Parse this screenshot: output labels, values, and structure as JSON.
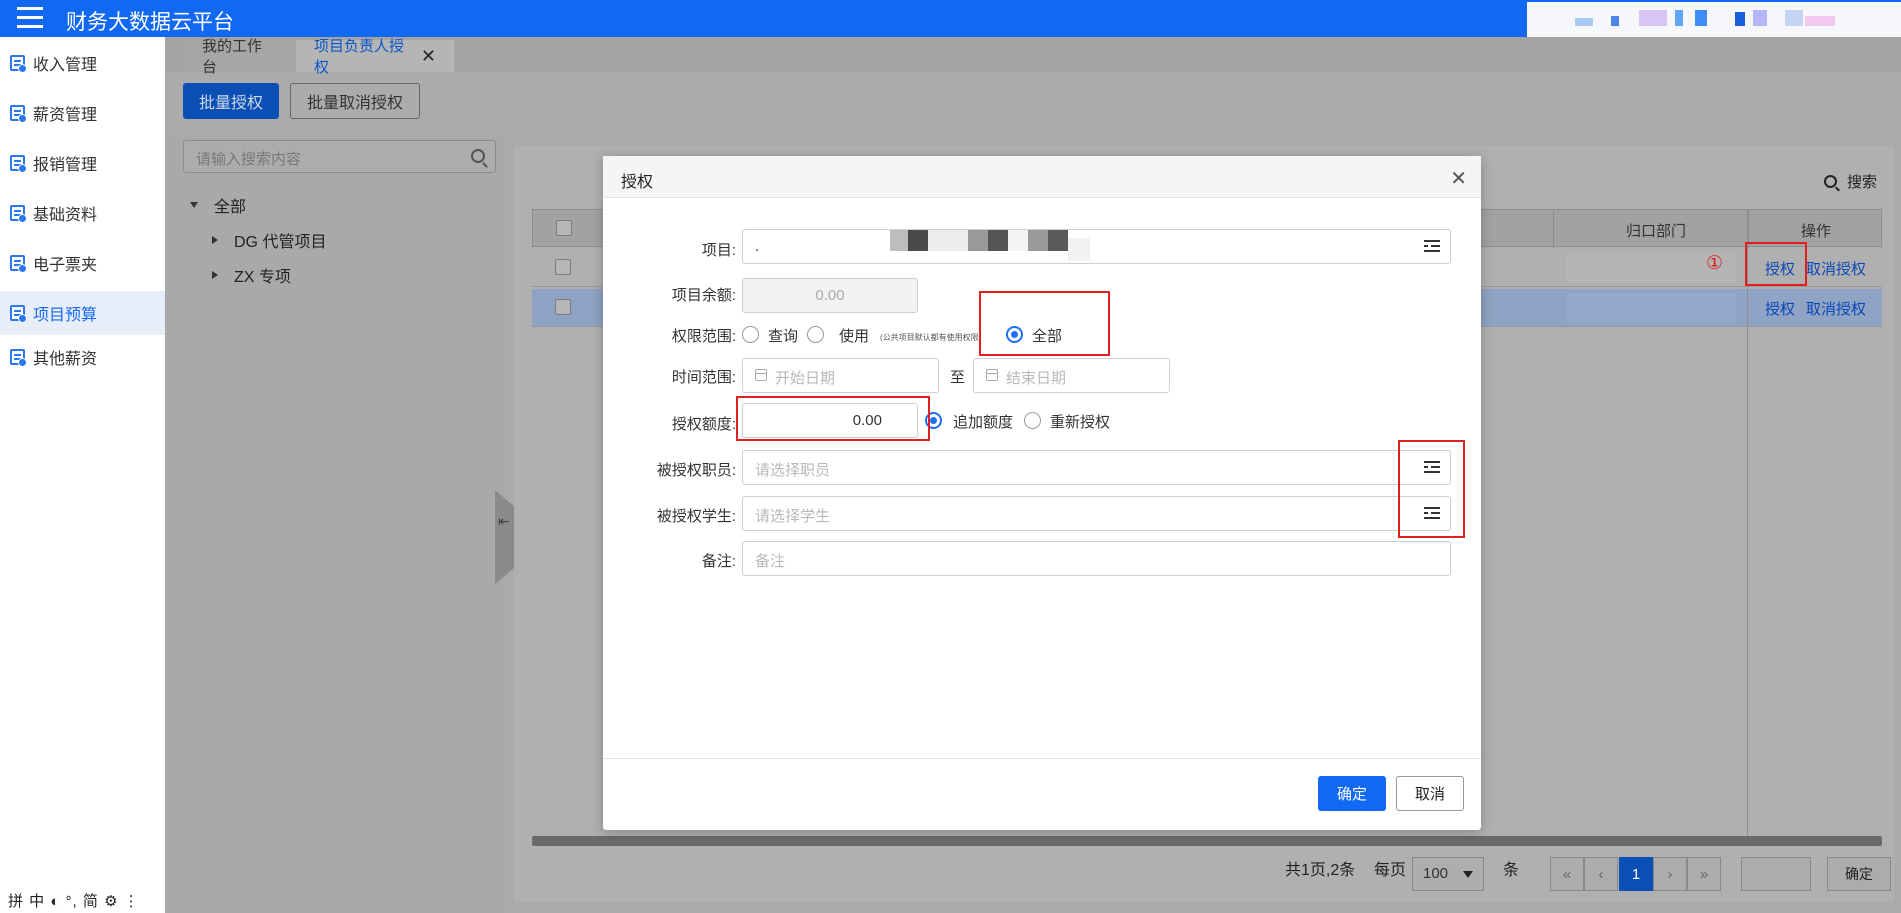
{
  "app": {
    "title": "财务大数据云平台"
  },
  "sidebar": {
    "items": [
      {
        "label": "收入管理"
      },
      {
        "label": "薪资管理"
      },
      {
        "label": "报销管理"
      },
      {
        "label": "基础资料"
      },
      {
        "label": "电子票夹"
      },
      {
        "label": "项目预算",
        "active": true
      },
      {
        "label": "其他薪资"
      }
    ],
    "ime_bar": "拼 中 ◐ °, 简 ⚙ ⋮"
  },
  "tabs": [
    {
      "label": "我的工作台"
    },
    {
      "label": "项目负责人授权",
      "active": true,
      "close": "✕"
    }
  ],
  "toolbar": {
    "batch_grant": "批量授权",
    "batch_revoke": "批量取消授权"
  },
  "tree": {
    "search_placeholder": "请输入搜索内容",
    "root": "全部",
    "children": [
      "DG 代管项目",
      "ZX 专项"
    ]
  },
  "grid": {
    "search_label": "搜索",
    "columns": {
      "dept": "归口部门",
      "ops": "操作"
    },
    "rows": [
      {
        "op_grant": "授权",
        "op_revoke": "取消授权"
      },
      {
        "op_grant": "授权",
        "op_revoke": "取消授权"
      }
    ]
  },
  "pager": {
    "summary": "共1页,2条",
    "per_page_label": "每页",
    "per_page_value": "100",
    "unit": "条",
    "buttons": {
      "first": "«",
      "prev": "‹",
      "next": "›",
      "last": "»"
    },
    "current_page": "1",
    "goto_label": "确定"
  },
  "annotation": {
    "circled_number": "①"
  },
  "modal": {
    "title": "授权",
    "close": "✕",
    "fields": {
      "project": {
        "label": "项目:",
        "value": "."
      },
      "balance": {
        "label": "项目余额:",
        "value": "0.00"
      },
      "scope": {
        "label": "权限范围:",
        "options": [
          "查询",
          "使用",
          "全部"
        ],
        "hint": "(公共项目默认都有使用权限)",
        "selected": "全部"
      },
      "time_range": {
        "label": "时间范围:",
        "start_placeholder": "开始日期",
        "separator": "至",
        "end_placeholder": "结束日期"
      },
      "amount": {
        "label": "授权额度:",
        "value": "0.00",
        "options": [
          "追加额度",
          "重新授权"
        ],
        "selected": "追加额度"
      },
      "staff": {
        "label": "被授权职员:",
        "placeholder": "请选择职员"
      },
      "student": {
        "label": "被授权学生:",
        "placeholder": "请选择学生"
      },
      "remark": {
        "label": "备注:",
        "placeholder": "备注"
      }
    },
    "ok": "确定",
    "cancel": "取消"
  },
  "colors": {
    "primary": "#1168f3",
    "annotation_red": "#e02020"
  }
}
